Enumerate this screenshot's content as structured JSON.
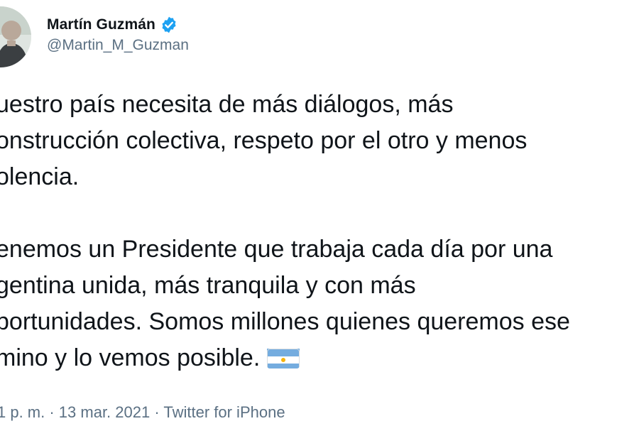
{
  "author": {
    "display_name": "Martín Guzmán",
    "handle": "@Martin_M_Guzman",
    "verified_icon": "verified-badge-icon",
    "badge_color": "#1da1f2"
  },
  "tweet": {
    "paragraph_1": "uestro país necesita de más diálogos, más\nonstrucción colectiva, respeto por el otro y menos\nolencia.",
    "paragraph_2": "enemos un Presidente que trabaja cada día por una\ngentina unida, más tranquila y con más\nportunidades. Somos millones quienes queremos ese\nmino y lo vemos posible.",
    "emoji": "argentina-flag-icon"
  },
  "meta": {
    "text": "1 p. m. · 13 mar. 2021 · Twitter for iPhone"
  }
}
